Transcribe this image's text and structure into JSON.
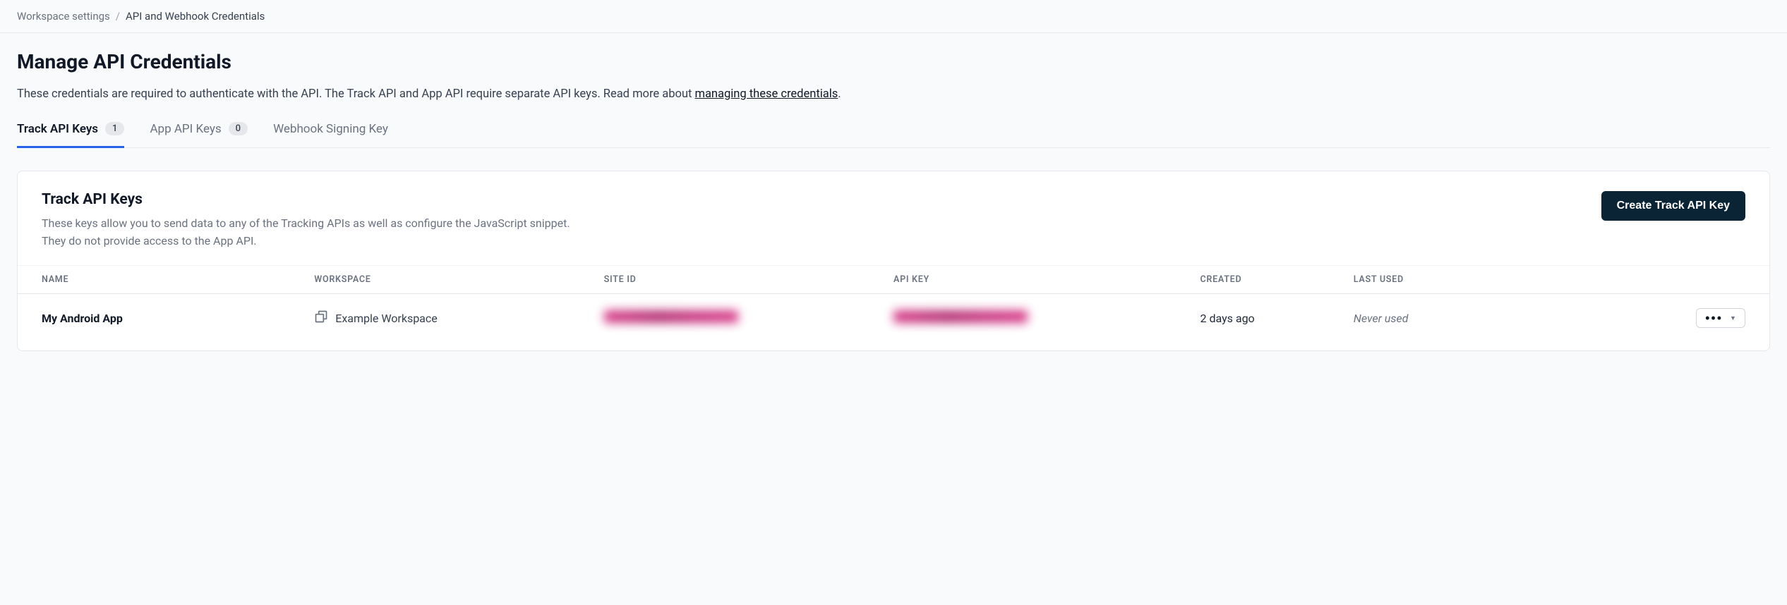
{
  "breadcrumb": {
    "parent": "Workspace settings",
    "separator": "/",
    "current": "API and Webhook Credentials"
  },
  "page": {
    "title": "Manage API Credentials",
    "description_pre": "These credentials are required to authenticate with the API. The Track API and App API require separate API keys. Read more about ",
    "description_link": "managing these credentials",
    "description_post": "."
  },
  "tabs": [
    {
      "label": "Track API Keys",
      "count": "1",
      "active": true
    },
    {
      "label": "App API Keys",
      "count": "0",
      "active": false
    },
    {
      "label": "Webhook Signing Key",
      "count": null,
      "active": false
    }
  ],
  "panel": {
    "title": "Track API Keys",
    "description": "These keys allow you to send data to any of the Tracking APIs as well as configure the JavaScript snippet. They do not provide access to the App API.",
    "create_button": "Create Track API Key"
  },
  "columns": {
    "name": "NAME",
    "workspace": "WORKSPACE",
    "site_id": "SITE ID",
    "api_key": "API KEY",
    "created": "CREATED",
    "last_used": "LAST USED"
  },
  "rows": [
    {
      "name": "My Android App",
      "workspace": "Example Workspace",
      "site_id_redacted": true,
      "api_key_redacted": true,
      "created": "2 days ago",
      "last_used": "Never used"
    }
  ]
}
